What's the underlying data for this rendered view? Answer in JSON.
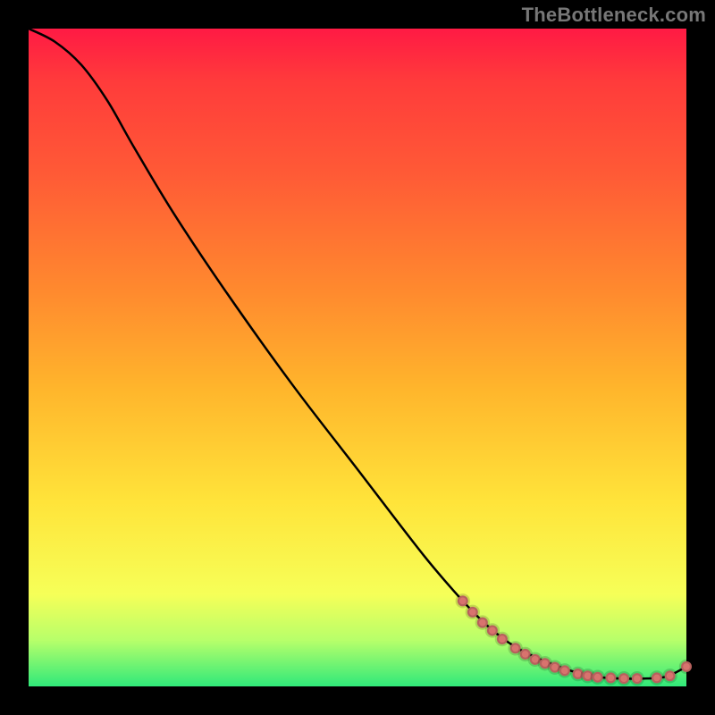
{
  "watermark": "TheBottleneck.com",
  "chart_data": {
    "type": "line",
    "title": "",
    "xlabel": "",
    "ylabel": "",
    "xlim": [
      0,
      100
    ],
    "ylim": [
      0,
      100
    ],
    "grid": false,
    "legend": false,
    "series": [
      {
        "name": "curve",
        "x": [
          0,
          4,
          8,
          12,
          16,
          22,
          30,
          40,
          50,
          60,
          66,
          70,
          74,
          78,
          82,
          86,
          90,
          94,
          97,
          100
        ],
        "y": [
          100,
          98,
          94.5,
          89,
          82,
          72,
          60,
          46,
          33,
          20,
          13,
          9,
          6,
          4,
          2.5,
          1.5,
          1.2,
          1.2,
          1.5,
          3
        ]
      }
    ],
    "markers": [
      {
        "x": 66.0,
        "y": 13.0
      },
      {
        "x": 67.5,
        "y": 11.3
      },
      {
        "x": 69.0,
        "y": 9.7
      },
      {
        "x": 70.5,
        "y": 8.5
      },
      {
        "x": 72.0,
        "y": 7.2
      },
      {
        "x": 74.0,
        "y": 5.8
      },
      {
        "x": 75.5,
        "y": 4.9
      },
      {
        "x": 77.0,
        "y": 4.1
      },
      {
        "x": 78.5,
        "y": 3.5
      },
      {
        "x": 80.0,
        "y": 2.9
      },
      {
        "x": 81.5,
        "y": 2.4
      },
      {
        "x": 83.5,
        "y": 1.9
      },
      {
        "x": 85.0,
        "y": 1.6
      },
      {
        "x": 86.5,
        "y": 1.4
      },
      {
        "x": 88.5,
        "y": 1.3
      },
      {
        "x": 90.5,
        "y": 1.2
      },
      {
        "x": 92.5,
        "y": 1.2
      },
      {
        "x": 95.5,
        "y": 1.3
      },
      {
        "x": 97.5,
        "y": 1.6
      },
      {
        "x": 100.0,
        "y": 3.0
      }
    ],
    "marker_style": {
      "shape": "circle",
      "color": "#d8736e",
      "radius_px": 6
    }
  }
}
